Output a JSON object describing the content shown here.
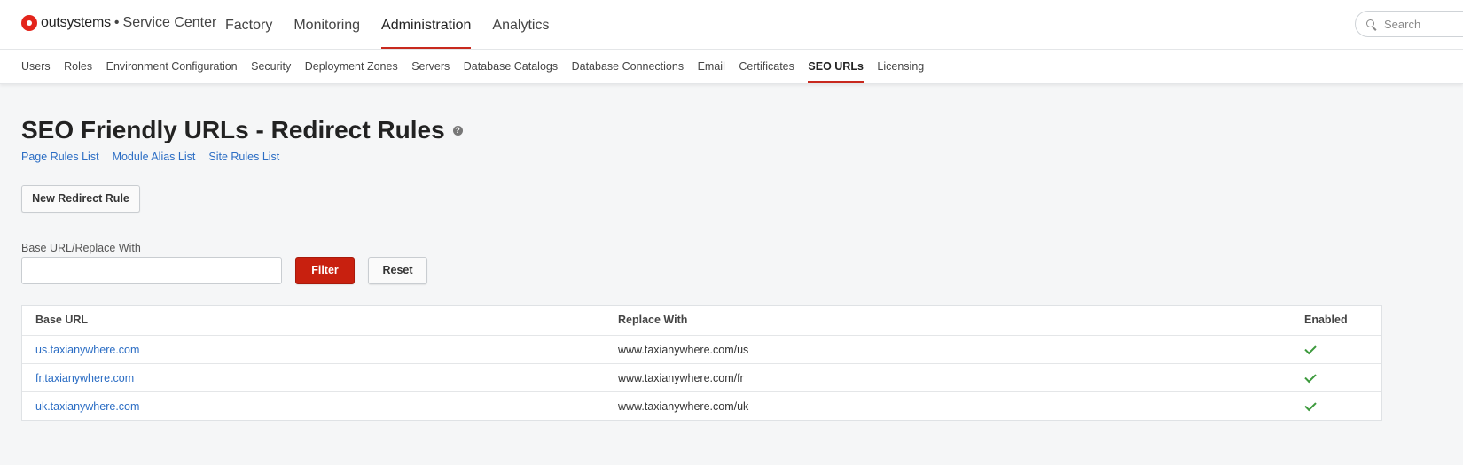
{
  "header": {
    "brand": "outsystems",
    "separator": "•",
    "product": "Service Center",
    "nav": [
      {
        "label": "Factory",
        "active": false
      },
      {
        "label": "Monitoring",
        "active": false
      },
      {
        "label": "Administration",
        "active": true
      },
      {
        "label": "Analytics",
        "active": false
      }
    ],
    "search_placeholder": "Search"
  },
  "subnav": [
    {
      "label": "Users",
      "active": false
    },
    {
      "label": "Roles",
      "active": false
    },
    {
      "label": "Environment Configuration",
      "active": false
    },
    {
      "label": "Security",
      "active": false
    },
    {
      "label": "Deployment Zones",
      "active": false
    },
    {
      "label": "Servers",
      "active": false
    },
    {
      "label": "Database Catalogs",
      "active": false
    },
    {
      "label": "Database Connections",
      "active": false
    },
    {
      "label": "Email",
      "active": false
    },
    {
      "label": "Certificates",
      "active": false
    },
    {
      "label": "SEO URLs",
      "active": true
    },
    {
      "label": "Licensing",
      "active": false
    }
  ],
  "page": {
    "title": "SEO Friendly URLs - Redirect Rules",
    "help_icon": "?",
    "links": [
      "Page Rules List",
      "Module Alias List",
      "Site Rules List"
    ],
    "new_button": "New Redirect Rule",
    "filter_label": "Base URL/Replace With",
    "filter_value": "",
    "filter_button": "Filter",
    "reset_button": "Reset"
  },
  "table": {
    "columns": [
      "Base URL",
      "Replace With",
      "Enabled"
    ],
    "rows": [
      {
        "base_url": "us.taxianywhere.com",
        "replace_with": "www.taxianywhere.com/us",
        "enabled": true
      },
      {
        "base_url": "fr.taxianywhere.com",
        "replace_with": "www.taxianywhere.com/fr",
        "enabled": true
      },
      {
        "base_url": "uk.taxianywhere.com",
        "replace_with": "www.taxianywhere.com/uk",
        "enabled": true
      }
    ]
  },
  "colors": {
    "accent": "#c8291e",
    "primary_button": "#c8200f",
    "link": "#2b6dc4",
    "check": "#3d9a3d"
  },
  "icons": [
    "outsystems-logo-icon",
    "search-icon",
    "help-icon",
    "check-icon"
  ]
}
